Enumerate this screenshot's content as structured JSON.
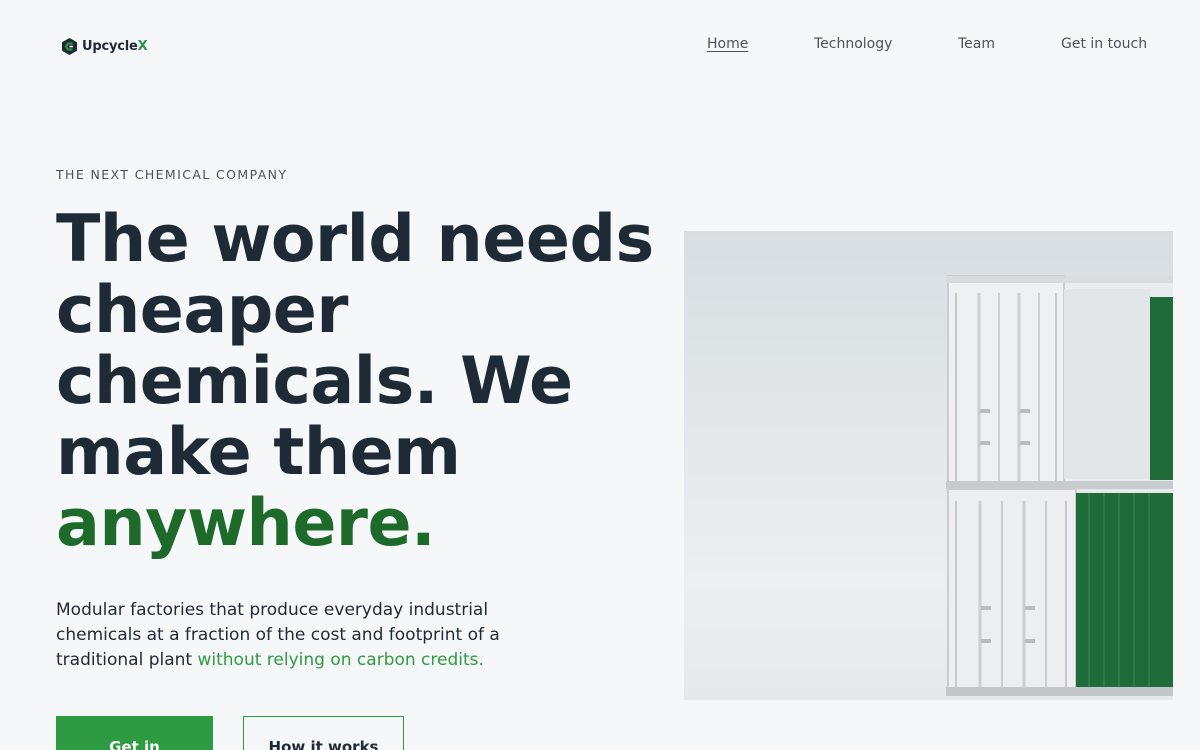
{
  "brand": {
    "name": "Upcycle",
    "name_suffix": "X"
  },
  "nav": {
    "items": [
      {
        "label": "Home",
        "active": true
      },
      {
        "label": "Technology",
        "active": false
      },
      {
        "label": "Team",
        "active": false
      },
      {
        "label": "Get in touch",
        "active": false
      }
    ]
  },
  "hero": {
    "eyebrow": "THE NEXT CHEMICAL COMPANY",
    "headline_main": "The world needs cheaper chemicals. We make them",
    "headline_accent": "anywhere.",
    "subtext_main": "Modular factories that produce everyday industrial chemicals at a fraction of the cost and footprint of a traditional plant ",
    "subtext_highlight": "without relying on carbon credits.",
    "primary_button": "Get in",
    "secondary_button": "How it works",
    "image_icon": "shipping-containers-image"
  },
  "colors": {
    "accent": "#2e9b43",
    "accent_dark": "#1e6a2b",
    "text": "#1f2a37",
    "background": "#f6f7f9",
    "container_green": "#1f6b3a"
  }
}
